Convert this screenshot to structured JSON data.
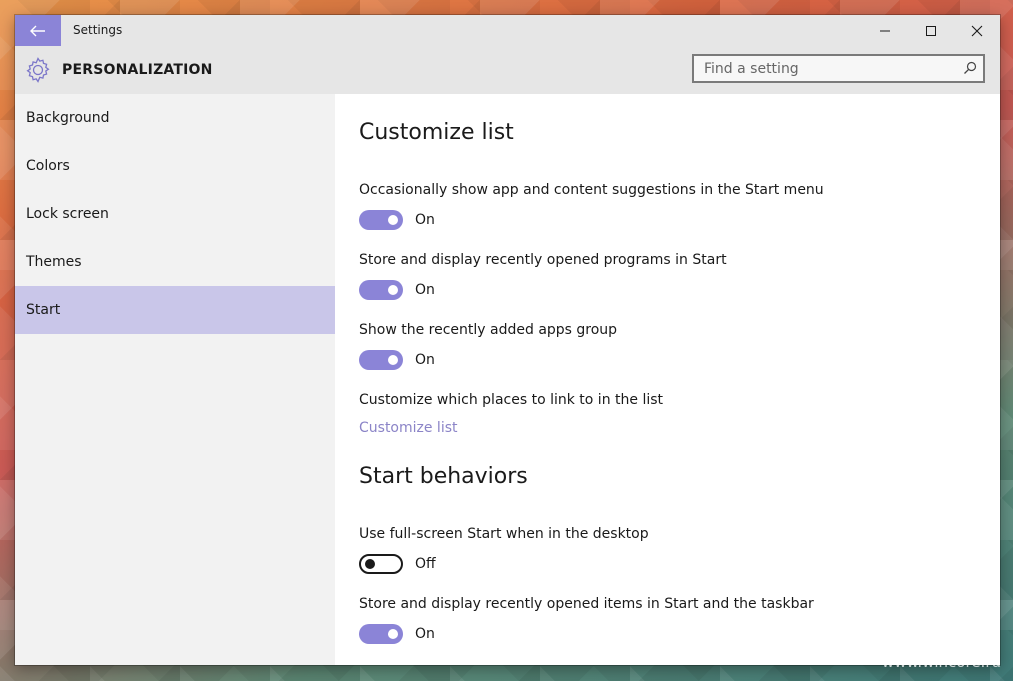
{
  "window": {
    "title": "Settings"
  },
  "header": {
    "title": "PERSONALIZATION"
  },
  "search": {
    "placeholder": "Find a setting",
    "value": ""
  },
  "sidebar": {
    "items": [
      {
        "label": "Background"
      },
      {
        "label": "Colors"
      },
      {
        "label": "Lock screen"
      },
      {
        "label": "Themes"
      },
      {
        "label": "Start",
        "active": true
      }
    ]
  },
  "customize_list": {
    "title": "Customize list",
    "settings": [
      {
        "label": "Occasionally show app and content suggestions in the Start menu",
        "state": "On"
      },
      {
        "label": "Store and display recently opened programs in Start",
        "state": "On"
      },
      {
        "label": "Show the recently added apps group",
        "state": "On"
      }
    ],
    "places_label": "Customize which places to link to in the list",
    "places_link": "Customize list"
  },
  "start_behaviors": {
    "title": "Start behaviors",
    "settings": [
      {
        "label": "Use full-screen Start when in the desktop",
        "state": "Off"
      },
      {
        "label": "Store and display recently opened items in Start and the taskbar",
        "state": "On"
      }
    ]
  },
  "watermark": "www.wincore.ru",
  "colors": {
    "accent": "#8b84d7",
    "selected_nav": "#c9c6e9",
    "chrome": "#e6e6e6"
  },
  "icons": {
    "back": "back-arrow-icon",
    "search": "search-icon",
    "header": "gear-icon"
  }
}
